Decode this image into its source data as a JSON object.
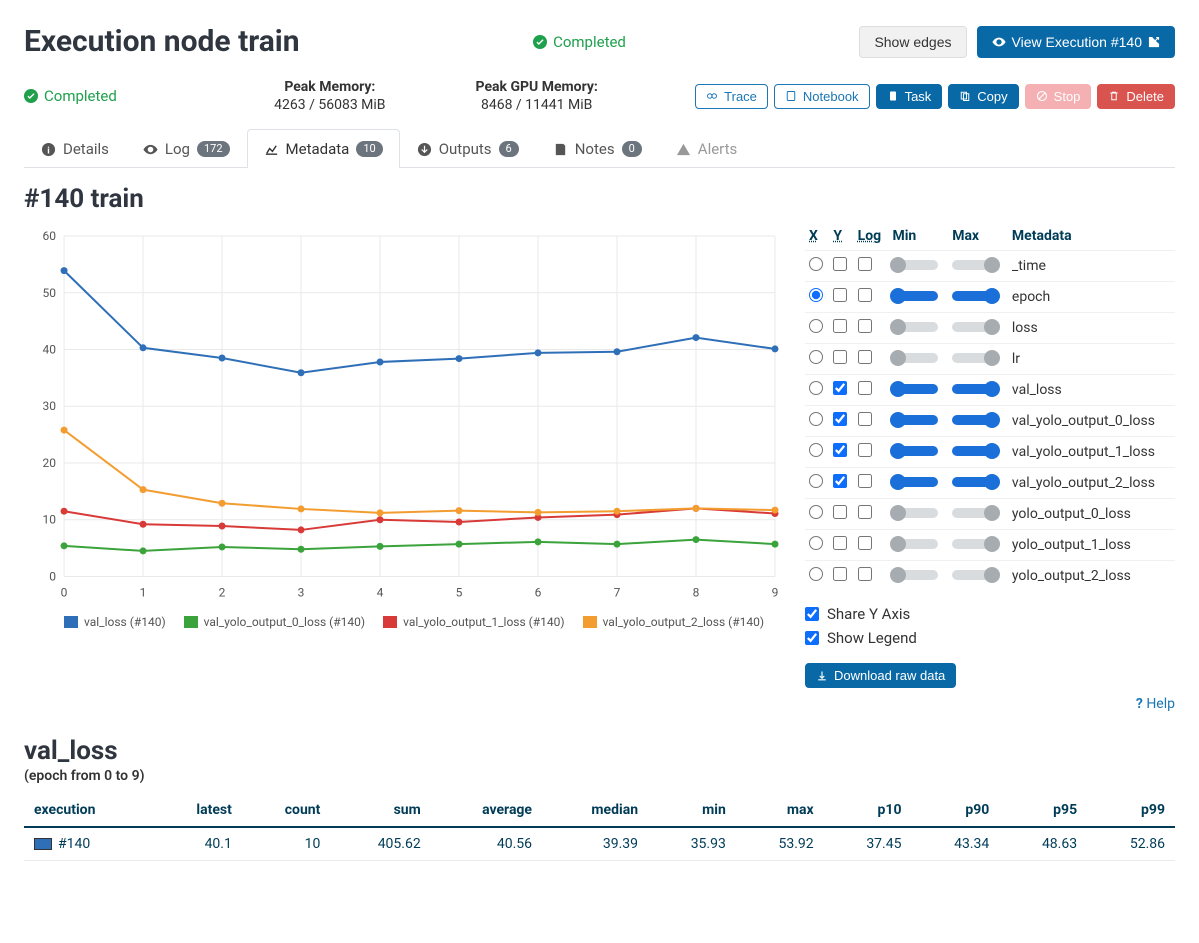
{
  "header": {
    "title": "Execution node train",
    "status": "Completed",
    "show_edges": "Show edges",
    "view_execution": "View Execution #140"
  },
  "stats": {
    "status": "Completed",
    "peak_mem_label": "Peak Memory:",
    "peak_mem_value": "4263 / 56083 MiB",
    "peak_gpu_label": "Peak GPU Memory:",
    "peak_gpu_value": "8468 / 11441 MiB",
    "actions": {
      "trace": "Trace",
      "notebook": "Notebook",
      "task": "Task",
      "copy": "Copy",
      "stop": "Stop",
      "delete": "Delete"
    }
  },
  "tabs": {
    "details": "Details",
    "log": "Log",
    "log_count": "172",
    "metadata": "Metadata",
    "metadata_count": "10",
    "outputs": "Outputs",
    "outputs_count": "6",
    "notes": "Notes",
    "notes_count": "0",
    "alerts": "Alerts"
  },
  "section_title": "#140 train",
  "chart_data": {
    "type": "line",
    "x": [
      0,
      1,
      2,
      3,
      4,
      5,
      6,
      7,
      8,
      9
    ],
    "y_ticks": [
      0,
      10,
      20,
      30,
      40,
      50,
      60
    ],
    "series": [
      {
        "name": "val_loss (#140)",
        "color": "#2f6fb7",
        "values": [
          53.9,
          40.3,
          38.5,
          35.9,
          37.8,
          38.4,
          39.4,
          39.6,
          42.1,
          40.1
        ]
      },
      {
        "name": "val_yolo_output_0_loss (#140)",
        "color": "#3ba33b",
        "values": [
          5.4,
          4.5,
          5.2,
          4.8,
          5.3,
          5.7,
          6.1,
          5.7,
          6.5,
          5.7
        ]
      },
      {
        "name": "val_yolo_output_1_loss (#140)",
        "color": "#d83a37",
        "values": [
          11.5,
          9.2,
          8.9,
          8.2,
          10.0,
          9.6,
          10.4,
          10.9,
          12.0,
          11.1
        ]
      },
      {
        "name": "val_yolo_output_2_loss (#140)",
        "color": "#f39c30",
        "values": [
          25.8,
          15.3,
          12.9,
          11.9,
          11.2,
          11.6,
          11.3,
          11.5,
          12.0,
          11.7
        ]
      }
    ]
  },
  "controls": {
    "headers": {
      "x": "X",
      "y": "Y",
      "log": "Log",
      "min": "Min",
      "max": "Max",
      "metadata": "Metadata"
    },
    "rows": [
      {
        "name": "_time",
        "x": false,
        "y": false,
        "log": false,
        "active": false
      },
      {
        "name": "epoch",
        "x": true,
        "y": false,
        "log": false,
        "active": true
      },
      {
        "name": "loss",
        "x": false,
        "y": false,
        "log": false,
        "active": false
      },
      {
        "name": "lr",
        "x": false,
        "y": false,
        "log": false,
        "active": false
      },
      {
        "name": "val_loss",
        "x": false,
        "y": true,
        "log": false,
        "active": true
      },
      {
        "name": "val_yolo_output_0_loss",
        "x": false,
        "y": true,
        "log": false,
        "active": true
      },
      {
        "name": "val_yolo_output_1_loss",
        "x": false,
        "y": true,
        "log": false,
        "active": true
      },
      {
        "name": "val_yolo_output_2_loss",
        "x": false,
        "y": true,
        "log": false,
        "active": true
      },
      {
        "name": "yolo_output_0_loss",
        "x": false,
        "y": false,
        "log": false,
        "active": false
      },
      {
        "name": "yolo_output_1_loss",
        "x": false,
        "y": false,
        "log": false,
        "active": false
      },
      {
        "name": "yolo_output_2_loss",
        "x": false,
        "y": false,
        "log": false,
        "active": false
      }
    ],
    "share_y": "Share Y Axis",
    "show_legend": "Show Legend",
    "download": "Download raw data",
    "help": "Help"
  },
  "summary": {
    "title": "val_loss",
    "subtitle": "(epoch from 0 to 9)",
    "headers": [
      "execution",
      "latest",
      "count",
      "sum",
      "average",
      "median",
      "min",
      "max",
      "p10",
      "p90",
      "p95",
      "p99"
    ],
    "row": {
      "exec": "#140",
      "color": "#2f6fb7",
      "latest": "40.1",
      "count": "10",
      "sum": "405.62",
      "average": "40.56",
      "median": "39.39",
      "min": "35.93",
      "max": "53.92",
      "p10": "37.45",
      "p90": "43.34",
      "p95": "48.63",
      "p99": "52.86"
    }
  }
}
